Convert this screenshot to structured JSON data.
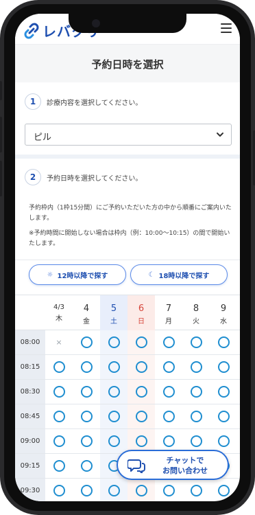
{
  "header": {
    "logo_text": "レバクリ",
    "logo_icon": "chain-link-logo",
    "menu_icon": "hamburger-menu-icon"
  },
  "page": {
    "title": "予約日時を選択"
  },
  "step1": {
    "number": "1",
    "label": "診療内容を選択してください。",
    "select_value": "ピル"
  },
  "step2": {
    "number": "2",
    "label": "予約日時を選択してください。",
    "note1": "予約枠内（1枠15分間）にご予約いただいた方の中から順番にご案内いたします。",
    "note2": "※予約時間に開始しない場合は枠内（例：10:00〜10:15）の間で開始いたします。"
  },
  "filters": {
    "noon_label": "12時以降で探す",
    "noon_icon": "sun-icon",
    "evening_label": "18時以降で探す",
    "evening_icon": "moon-icon"
  },
  "calendar": {
    "days": [
      {
        "date": "4/3",
        "weekday": "木",
        "kind": "weekday"
      },
      {
        "date": "4",
        "weekday": "金",
        "kind": "weekday"
      },
      {
        "date": "5",
        "weekday": "土",
        "kind": "sat"
      },
      {
        "date": "6",
        "weekday": "日",
        "kind": "sun"
      },
      {
        "date": "7",
        "weekday": "月",
        "kind": "weekday"
      },
      {
        "date": "8",
        "weekday": "火",
        "kind": "weekday"
      },
      {
        "date": "9",
        "weekday": "水",
        "kind": "weekday"
      }
    ],
    "rows": [
      {
        "time": "08:00",
        "slots": [
          "×",
          "○",
          "○",
          "○",
          "○",
          "○",
          "○"
        ]
      },
      {
        "time": "08:15",
        "slots": [
          "○",
          "○",
          "○",
          "○",
          "○",
          "○",
          "○"
        ]
      },
      {
        "time": "08:30",
        "slots": [
          "○",
          "○",
          "○",
          "○",
          "○",
          "○",
          "○"
        ]
      },
      {
        "time": "08:45",
        "slots": [
          "○",
          "○",
          "○",
          "○",
          "○",
          "○",
          "○"
        ]
      },
      {
        "time": "09:00",
        "slots": [
          "○",
          "○",
          "○",
          "○",
          "○",
          "○",
          "○"
        ]
      },
      {
        "time": "09:15",
        "slots": [
          "○",
          "○",
          "○",
          "○",
          "○",
          "○",
          "○"
        ]
      },
      {
        "time": "09:30",
        "slots": [
          "○",
          "○",
          "○",
          "○",
          "○",
          "○",
          "○"
        ]
      }
    ],
    "colors": {
      "available": "#1f8ed0",
      "sat": "#1e4fb0",
      "sun": "#d6453a"
    }
  },
  "chat": {
    "line1": "チャットで",
    "line2": "お問い合わせ",
    "icon": "chat-bubbles-icon"
  }
}
